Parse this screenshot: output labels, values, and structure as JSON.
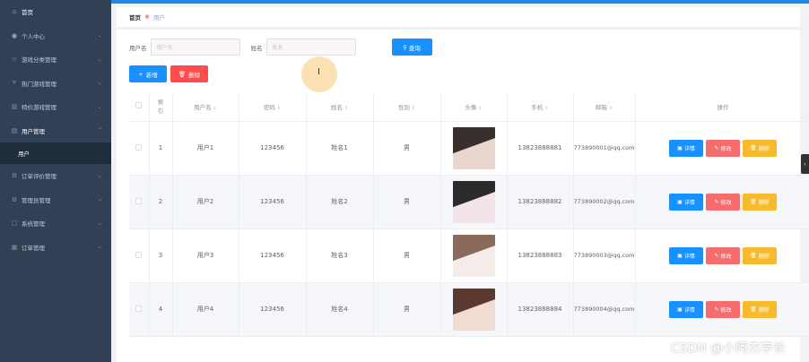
{
  "sidebar": {
    "items": [
      {
        "label": "首页",
        "icon": "home-icon",
        "has_arrow": false
      },
      {
        "label": "个人中心",
        "icon": "user-icon",
        "has_arrow": true
      },
      {
        "label": "游戏分类管理",
        "icon": "tag-icon",
        "has_arrow": true
      },
      {
        "label": "热门游戏管理",
        "icon": "crop-icon",
        "has_arrow": true
      },
      {
        "label": "特价游戏管理",
        "icon": "chart-icon",
        "has_arrow": true
      },
      {
        "label": "用户管理",
        "icon": "list-icon",
        "has_arrow": true,
        "expanded": true
      }
    ],
    "sub_item": "用户",
    "items_after": [
      {
        "label": "订单评价管理",
        "icon": "gear-icon",
        "has_arrow": true
      },
      {
        "label": "管理员管理",
        "icon": "gear-icon",
        "has_arrow": true
      },
      {
        "label": "系统管理",
        "icon": "box-icon",
        "has_arrow": true
      },
      {
        "label": "订单管理",
        "icon": "doc-icon",
        "has_arrow": true
      }
    ]
  },
  "breadcrumb": {
    "home": "首页",
    "current": "用户"
  },
  "search": {
    "username_label": "用户名",
    "username_placeholder": "用户名",
    "name_label": "姓名",
    "name_placeholder": "姓名",
    "search_button": "查询"
  },
  "actions": {
    "add": "新增",
    "delete": "删除"
  },
  "table": {
    "headers": [
      "索引",
      "用户名",
      "密码",
      "姓名",
      "性别",
      "头像",
      "手机",
      "邮箱",
      "操作"
    ],
    "rows": [
      {
        "index": "1",
        "username": "用户1",
        "password": "123456",
        "name": "姓名1",
        "gender": "男",
        "phone": "13823888881",
        "email": "773890001@qq.com"
      },
      {
        "index": "2",
        "username": "用户2",
        "password": "123456",
        "name": "姓名2",
        "gender": "男",
        "phone": "13823888882",
        "email": "773890002@qq.com"
      },
      {
        "index": "3",
        "username": "用户3",
        "password": "123456",
        "name": "姓名3",
        "gender": "男",
        "phone": "13823888883",
        "email": "773890003@qq.com"
      },
      {
        "index": "4",
        "username": "用户4",
        "password": "123456",
        "name": "姓名4",
        "gender": "男",
        "phone": "13823888884",
        "email": "773890004@qq.com"
      }
    ],
    "row_buttons": {
      "detail": "详情",
      "edit": "修改",
      "delete": "删除"
    }
  },
  "watermark": "CSDN @小阿杰学长",
  "colors": {
    "sidebar_bg": "#304156",
    "primary": "#1890ff",
    "danger": "#ff4d4f",
    "warning": "#f7ba2a",
    "edit": "#f56c6c"
  }
}
